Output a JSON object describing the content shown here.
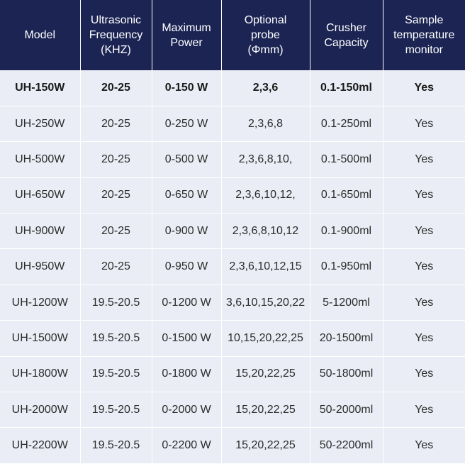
{
  "table": {
    "headers": [
      [
        "Model"
      ],
      [
        "Ultrasonic",
        "Frequency",
        "(KHZ)"
      ],
      [
        "Maximum",
        "Power"
      ],
      [
        "Optional",
        "probe",
        "(Φmm)"
      ],
      [
        "Crusher",
        "Capacity"
      ],
      [
        "Sample",
        "temperature",
        "monitor"
      ]
    ],
    "rows": [
      [
        "UH-150W",
        "20-25",
        "0-150 W",
        "2,3,6",
        "0.1-150ml",
        "Yes"
      ],
      [
        "UH-250W",
        "20-25",
        "0-250 W",
        "2,3,6,8",
        "0.1-250ml",
        "Yes"
      ],
      [
        "UH-500W",
        "20-25",
        "0-500 W",
        "2,3,6,8,10,",
        "0.1-500ml",
        "Yes"
      ],
      [
        "UH-650W",
        "20-25",
        "0-650 W",
        "2,3,6,10,12,",
        "0.1-650ml",
        "Yes"
      ],
      [
        "UH-900W",
        "20-25",
        "0-900 W",
        "2,3,6,8,10,12",
        "0.1-900ml",
        "Yes"
      ],
      [
        "UH-950W",
        "20-25",
        "0-950 W",
        "2,3,6,10,12,15",
        "0.1-950ml",
        "Yes"
      ],
      [
        "UH-1200W",
        "19.5-20.5",
        "0-1200 W",
        "3,6,10,15,20,22",
        "5-1200ml",
        "Yes"
      ],
      [
        "UH-1500W",
        "19.5-20.5",
        "0-1500 W",
        "10,15,20,22,25",
        "20-1500ml",
        "Yes"
      ],
      [
        "UH-1800W",
        "19.5-20.5",
        "0-1800 W",
        "15,20,22,25",
        "50-1800ml",
        "Yes"
      ],
      [
        "UH-2000W",
        "19.5-20.5",
        "0-2000 W",
        "15,20,22,25",
        "50-2000ml",
        "Yes"
      ],
      [
        "UH-2200W",
        "19.5-20.5",
        "0-2200 W",
        "15,20,22,25",
        "50-2200ml",
        "Yes"
      ]
    ]
  },
  "colors": {
    "header_bg": "#1b2453",
    "row_bg": "#eaedf5"
  }
}
